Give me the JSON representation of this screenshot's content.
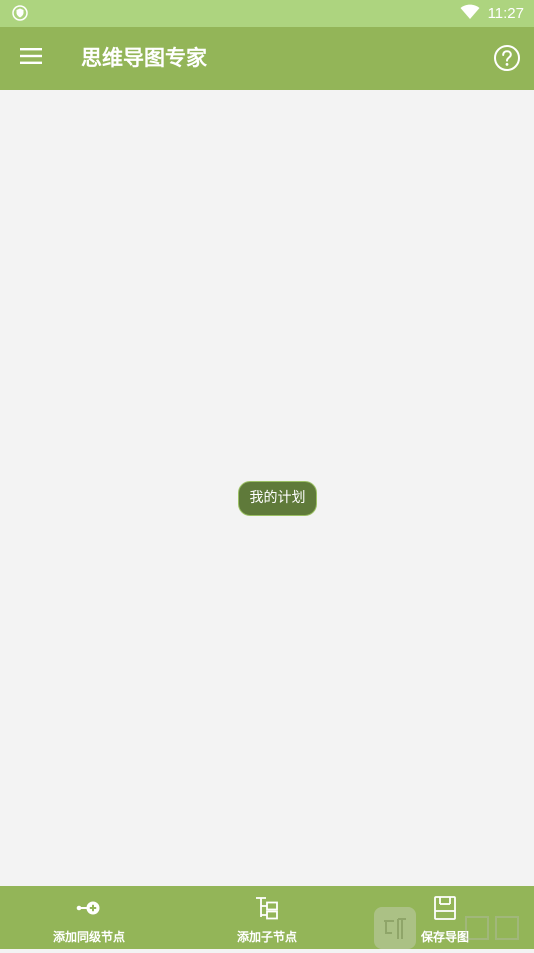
{
  "status_bar": {
    "time": "11:27",
    "left_icon": "shield-icon",
    "right_icons": [
      "wifi-icon"
    ]
  },
  "app_bar": {
    "title": "思维导图专家",
    "menu_icon": "menu-icon",
    "help_icon": "help-icon"
  },
  "canvas": {
    "root_node": "我的计划"
  },
  "bottom_bar": {
    "items": [
      {
        "label": "添加同级节点",
        "icon": "add-sibling-icon"
      },
      {
        "label": "添加子节点",
        "icon": "add-child-icon"
      },
      {
        "label": "保存导图",
        "icon": "save-icon"
      }
    ]
  },
  "colors": {
    "status_bar": "#add47f",
    "app_bar": "#93b558",
    "canvas": "#f3f3f3",
    "node_fill": "#5f7a3a",
    "node_border": "#9bc064"
  }
}
